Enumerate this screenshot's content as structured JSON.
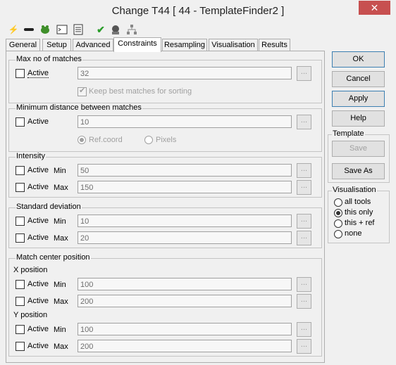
{
  "window": {
    "title": "Change T44 [ 44 - TemplateFinder2 ]",
    "close_symbol": "✕"
  },
  "toolbar": {
    "icons": [
      "lightning-icon",
      "link-icon",
      "frog-icon",
      "console-icon",
      "document-icon",
      "check-icon",
      "robot-icon",
      "network-icon"
    ]
  },
  "tabs": [
    "General",
    "Setup",
    "Advanced",
    "Constraints",
    "Resampling",
    "Visualisation",
    "Results"
  ],
  "active_tab": "Constraints",
  "max_matches": {
    "label": "Max no of matches",
    "active_label": "Active",
    "value": "32",
    "keep_best_label": "Keep best matches for sorting",
    "keep_best_checked": true
  },
  "min_distance": {
    "label": "Minimum distance between matches",
    "active_label": "Active",
    "value": "10",
    "radio_ref": "Ref.coord",
    "radio_pixels": "Pixels",
    "selected": "Ref.coord"
  },
  "intensity": {
    "label": "Intensity",
    "rows": [
      {
        "active_label": "Active",
        "bound": "Min",
        "value": "50"
      },
      {
        "active_label": "Active",
        "bound": "Max",
        "value": "150"
      }
    ]
  },
  "std_dev": {
    "label": "Standard deviation",
    "rows": [
      {
        "active_label": "Active",
        "bound": "Min",
        "value": "10"
      },
      {
        "active_label": "Active",
        "bound": "Max",
        "value": "20"
      }
    ]
  },
  "match_center": {
    "label": "Match center position",
    "x_label": "X position",
    "y_label": "Y position",
    "x_rows": [
      {
        "active_label": "Active",
        "bound": "Min",
        "value": "100"
      },
      {
        "active_label": "Active",
        "bound": "Max",
        "value": "200"
      }
    ],
    "y_rows": [
      {
        "active_label": "Active",
        "bound": "Min",
        "value": "100"
      },
      {
        "active_label": "Active",
        "bound": "Max",
        "value": "200"
      }
    ]
  },
  "dots_label": "...",
  "buttons": {
    "ok": "OK",
    "cancel": "Cancel",
    "apply": "Apply",
    "help": "Help"
  },
  "template": {
    "label": "Template",
    "save": "Save",
    "save_as": "Save As"
  },
  "visualisation": {
    "label": "Visualisation",
    "options": [
      "all tools",
      "this only",
      "this + ref",
      "none"
    ],
    "selected": "this only"
  },
  "colors": {
    "close_button": "#c75050",
    "default_button_border": "#3c7fb1",
    "check_green": "#2a9d2a"
  }
}
